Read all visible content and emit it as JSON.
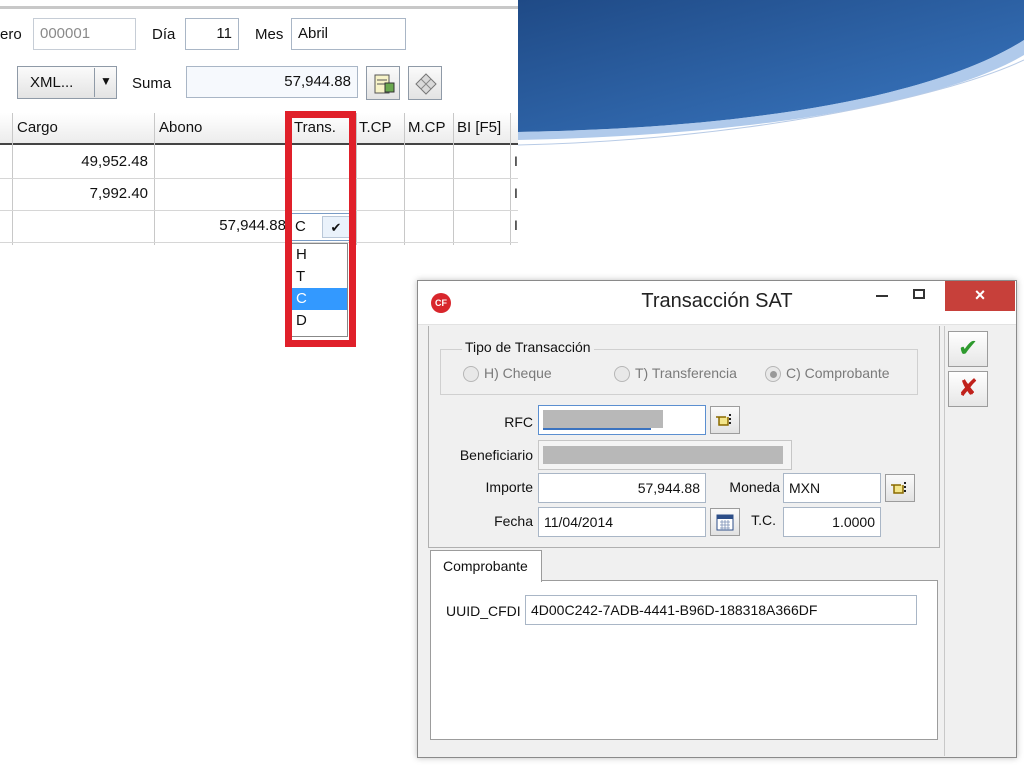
{
  "poliza": {
    "numero_label": "ero",
    "numero_value": "000001",
    "dia_label": "Día",
    "dia_value": "11",
    "mes_label": "Mes",
    "mes_value": "Abril",
    "xml_label": "XML...",
    "suma_label": "Suma",
    "suma_value": "57,944.88"
  },
  "grid": {
    "headers": [
      "Cargo",
      "Abono",
      "Trans.",
      "T.CP",
      "M.CP",
      "BI [F5]"
    ],
    "rows": [
      {
        "cargo": "49,952.48",
        "abono": "",
        "trans": ""
      },
      {
        "cargo": "7,992.40",
        "abono": "",
        "trans": ""
      },
      {
        "cargo": "",
        "abono": "57,944.88",
        "trans": "C"
      }
    ],
    "dropdown_options": [
      "H",
      "T",
      "C",
      "D"
    ],
    "dropdown_selected": "C"
  },
  "dialog": {
    "title": "Transacción SAT",
    "close_glyph": "×",
    "group_label": "Tipo de Transacción",
    "radio_options": [
      "H) Cheque",
      "T) Transferencia",
      "C) Comprobante"
    ],
    "radio_selected": "C) Comprobante",
    "rfc_label": "RFC",
    "beneficiario_label": "Beneficiario",
    "importe_label": "Importe",
    "importe_value": "57,944.88",
    "moneda_label": "Moneda",
    "moneda_value": "MXN",
    "fecha_label": "Fecha",
    "fecha_value": "11/04/2014",
    "tc_label": "T.C.",
    "tc_value": "1.0000",
    "tab_label": "Comprobante",
    "uuid_label": "UUID_CFDI",
    "uuid_value": "4D00C242-7ADB-4441-B96D-188318A366DF"
  },
  "colors": {
    "highlight_red": "#e0202a",
    "selection_blue": "#3399ff",
    "close_red": "#c7403a",
    "ok_green": "#2e9a2e",
    "cancel_red": "#c0211b"
  }
}
